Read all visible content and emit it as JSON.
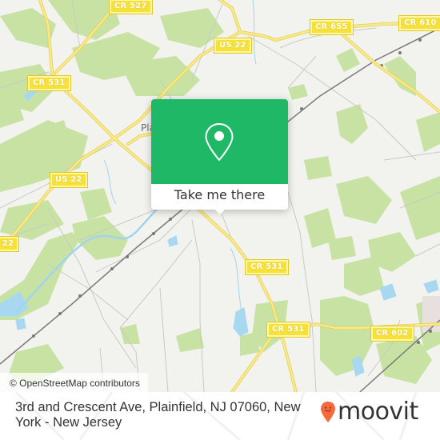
{
  "map": {
    "road_labels": [
      {
        "id": "cr527",
        "text": "CR 527"
      },
      {
        "id": "us22-top",
        "text": "US 22"
      },
      {
        "id": "cr655",
        "text": "CR 655"
      },
      {
        "id": "cr610",
        "text": "CR 610"
      },
      {
        "id": "cr531-top",
        "text": "CR 531"
      },
      {
        "id": "us22-left",
        "text": "US 22"
      },
      {
        "id": "us22-edge",
        "text": "22"
      },
      {
        "id": "cr531-mid",
        "text": "CR 531"
      },
      {
        "id": "cr531-low",
        "text": "CR 531"
      },
      {
        "id": "cr602",
        "text": "CR 602"
      }
    ],
    "place_labels": [
      {
        "id": "plainfield-partial",
        "text": "Pla"
      }
    ],
    "colors": {
      "background": "#f2f2ee",
      "park": "#c8e2a4",
      "water": "#a8d8ef",
      "road_major": "#f5e06a",
      "road_minor": "#c9c9c4",
      "rail": "#777777"
    }
  },
  "popup": {
    "icon": "map-pin-icon",
    "action_label": "Take me there",
    "color": "#1fb866"
  },
  "attribution": "© OpenStreetMap contributors",
  "footer": {
    "address": "3rd and Crescent Ave, Plainfield, NJ 07060, New York - New Jersey",
    "brand_name": "moovit",
    "brand_color": "#f26a3d"
  }
}
